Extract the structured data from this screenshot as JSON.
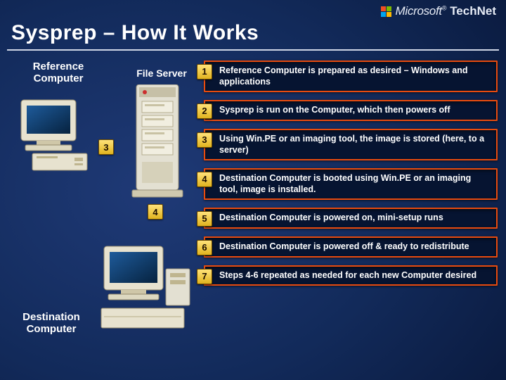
{
  "brand": {
    "company": "Microsoft",
    "product": "TechNet"
  },
  "title": "Sysprep – How It Works",
  "labels": {
    "reference": "Reference Computer",
    "fileserver": "File Server",
    "destination": "Destination Computer"
  },
  "diagram_badges": {
    "three": "3",
    "four": "4"
  },
  "steps": [
    {
      "n": "1",
      "text": "Reference Computer is prepared as desired – Windows and applications"
    },
    {
      "n": "2",
      "text": "Sysprep is run on the Computer, which then powers off"
    },
    {
      "n": "3",
      "text": "Using Win.PE or an imaging tool, the image is stored (here, to a server)"
    },
    {
      "n": "4",
      "text": "Destination Computer is booted using Win.PE or an imaging tool, image is installed."
    },
    {
      "n": "5",
      "text": "Destination Computer is powered on, mini-setup runs"
    },
    {
      "n": "6",
      "text": "Destination Computer is powered off & ready to redistribute"
    },
    {
      "n": "7",
      "text": "Steps 4-6 repeated as needed for each new Computer desired"
    }
  ]
}
